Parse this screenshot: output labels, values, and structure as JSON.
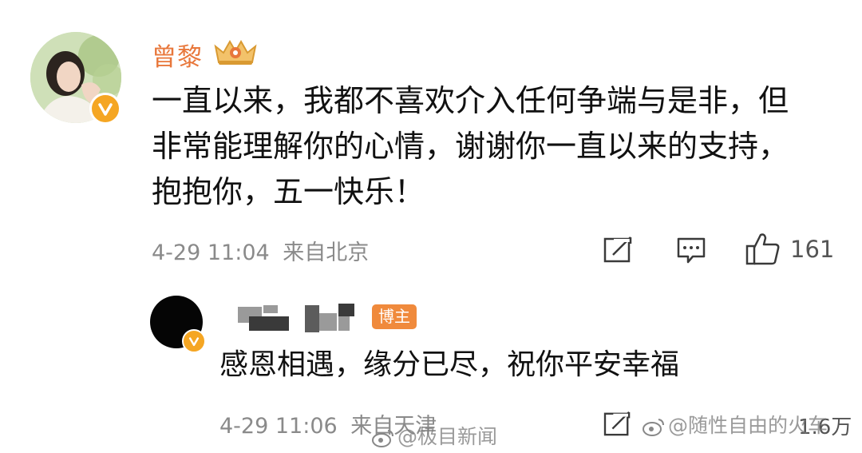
{
  "comment": {
    "username": "曾黎",
    "lines": [
      "一直以来，我都不喜欢介入任何争端与是非，但",
      "非常能理解你的心情，谢谢你一直以来的支持，",
      "抱抱你，五一快乐！"
    ],
    "time": "4-29 11:04",
    "location": "来自北京",
    "like_count": "161"
  },
  "reply": {
    "author_tag": "博主",
    "text": "感恩相遇，缘分已尽，祝你平安幸福",
    "time": "4-29 11:06",
    "location": "来自天津",
    "like_count": "1.6万"
  },
  "watermarks": {
    "left": "@极目新闻",
    "right": "@随性自由的火车"
  },
  "colors": {
    "username": "#e8773b",
    "meta": "#8a8a8a",
    "verify_badge": "#f5a623",
    "author_tag": "#f08a3c"
  },
  "icons": [
    "verified-badge-icon",
    "crown-badge-icon",
    "repost-icon",
    "comment-icon",
    "like-icon",
    "weibo-logo-icon"
  ]
}
